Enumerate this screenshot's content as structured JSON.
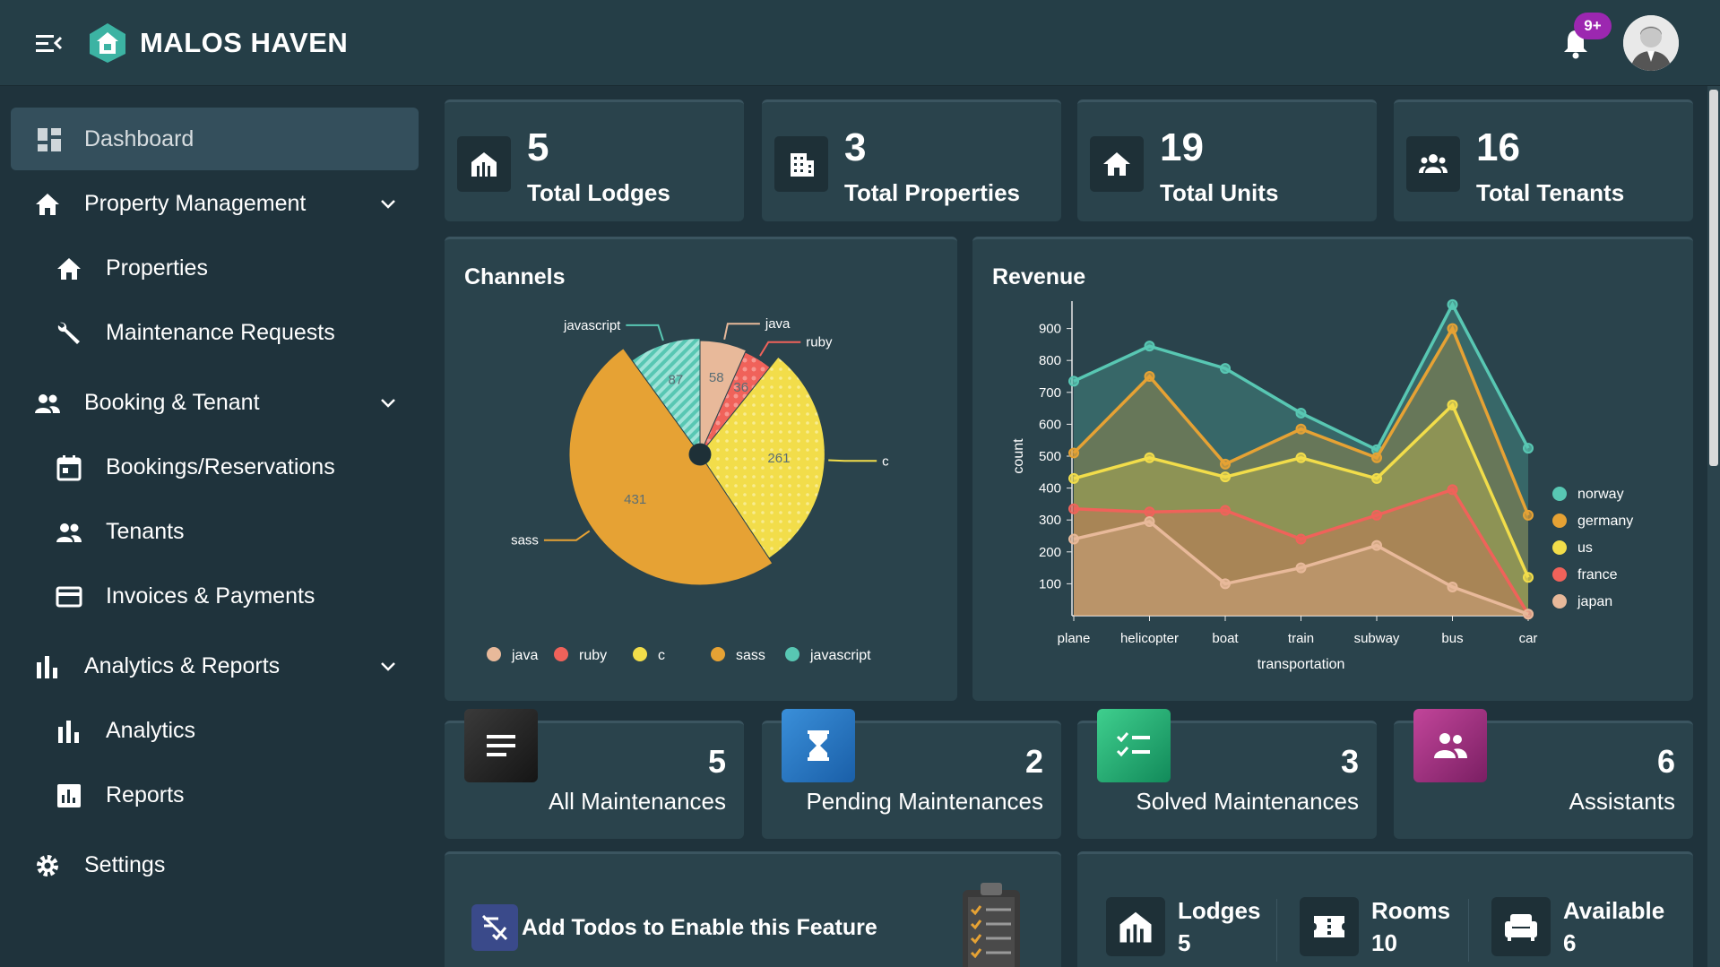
{
  "header": {
    "brand": "MALOS HAVEN",
    "notification_count": "9+"
  },
  "sidebar": {
    "items": [
      {
        "label": "Dashboard"
      },
      {
        "label": "Property Management"
      },
      {
        "label": "Properties"
      },
      {
        "label": "Maintenance Requests"
      },
      {
        "label": "Booking & Tenant"
      },
      {
        "label": "Bookings/Reservations"
      },
      {
        "label": "Tenants"
      },
      {
        "label": "Invoices & Payments"
      },
      {
        "label": "Analytics & Reports"
      },
      {
        "label": "Analytics"
      },
      {
        "label": "Reports"
      },
      {
        "label": "Settings"
      }
    ]
  },
  "stats": [
    {
      "value": "5",
      "label": "Total Lodges"
    },
    {
      "value": "3",
      "label": "Total Properties"
    },
    {
      "value": "19",
      "label": "Total Units"
    },
    {
      "value": "16",
      "label": "Total Tenants"
    }
  ],
  "maintenance": [
    {
      "value": "5",
      "label": "All Maintenances"
    },
    {
      "value": "2",
      "label": "Pending Maintenances"
    },
    {
      "value": "3",
      "label": "Solved Maintenances"
    },
    {
      "value": "6",
      "label": "Assistants"
    }
  ],
  "todo": {
    "label": "Add Todos to Enable this Feature"
  },
  "bottom": [
    {
      "label": "Lodges",
      "value": "5"
    },
    {
      "label": "Rooms",
      "value": "10"
    },
    {
      "label": "Available",
      "value": "6"
    }
  ],
  "colors": {
    "java": "#e8b99a",
    "ruby": "#f0625a",
    "c": "#f2dd4a",
    "sass": "#e6a234",
    "javascript": "#58c7b3"
  },
  "chart_data": [
    {
      "type": "pie",
      "title": "Channels",
      "labels": [
        "java",
        "ruby",
        "c",
        "sass",
        "javascript"
      ],
      "values": [
        58,
        36,
        261,
        431,
        87
      ],
      "legend": "bottom"
    },
    {
      "type": "area",
      "title": "Revenue",
      "xlabel": "transportation",
      "ylabel": "count",
      "categories": [
        "plane",
        "helicopter",
        "boat",
        "train",
        "subway",
        "bus",
        "car"
      ],
      "yticks": [
        100,
        200,
        300,
        400,
        500,
        600,
        700,
        800,
        900
      ],
      "ylim": [
        0,
        1000
      ],
      "legend": "right",
      "series": [
        {
          "name": "norway",
          "color": "#58c7b3",
          "values": [
            735,
            845,
            775,
            635,
            520,
            975,
            525
          ]
        },
        {
          "name": "germany",
          "color": "#e6a234",
          "values": [
            510,
            750,
            475,
            585,
            495,
            900,
            315
          ]
        },
        {
          "name": "us",
          "color": "#f2dd4a",
          "values": [
            430,
            495,
            435,
            495,
            430,
            660,
            120
          ]
        },
        {
          "name": "france",
          "color": "#f0625a",
          "values": [
            335,
            325,
            330,
            240,
            315,
            395,
            5
          ]
        },
        {
          "name": "japan",
          "color": "#e8b99a",
          "values": [
            240,
            295,
            100,
            150,
            220,
            90,
            5
          ]
        }
      ]
    }
  ]
}
